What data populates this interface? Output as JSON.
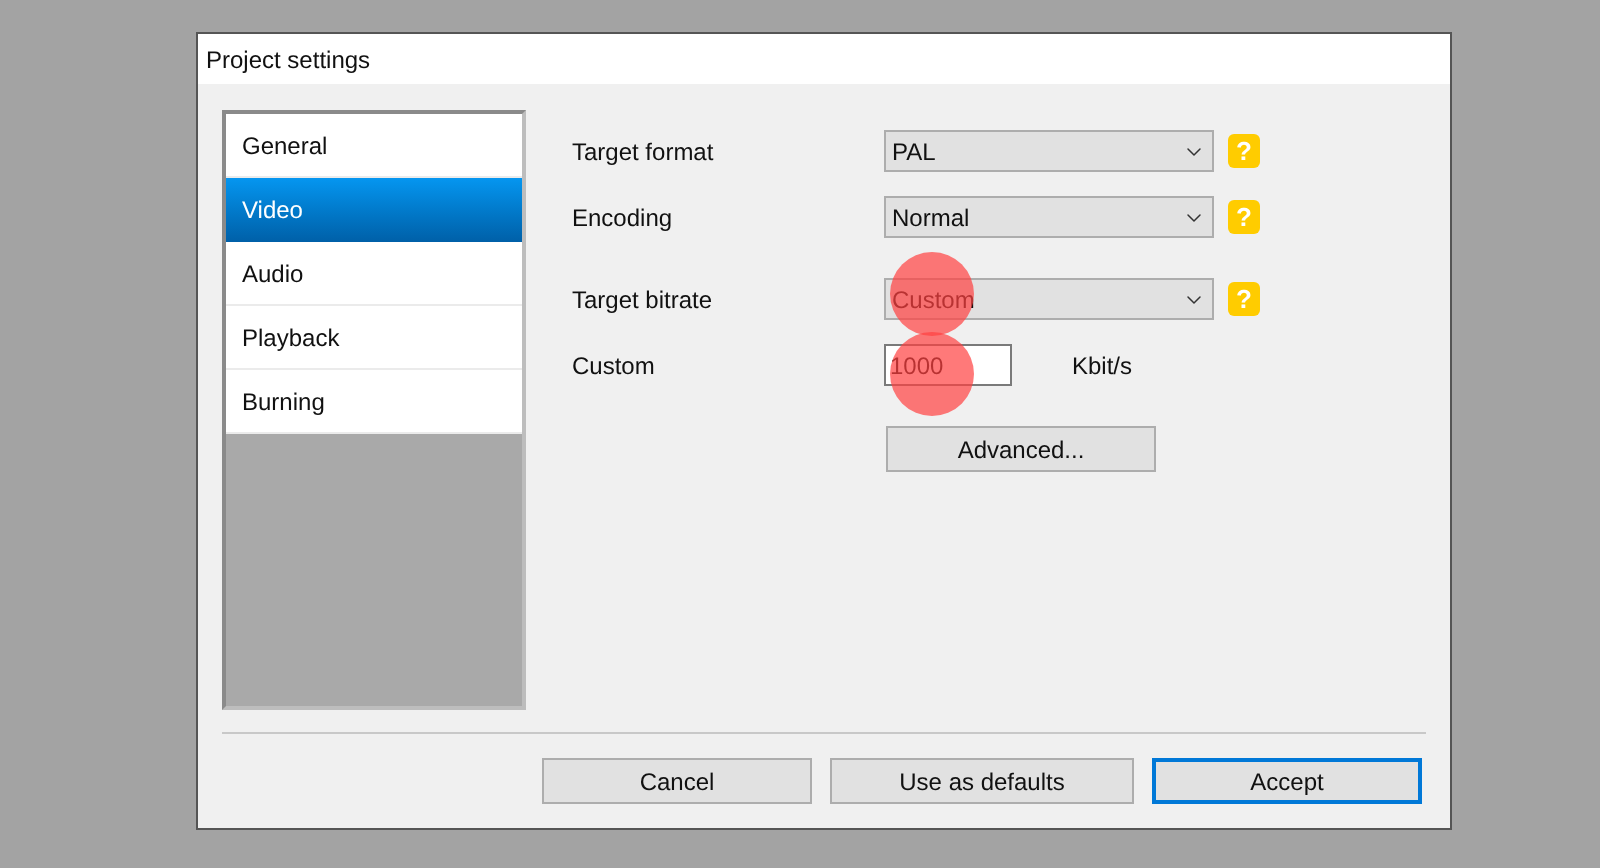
{
  "window": {
    "title": "Project settings"
  },
  "sidebar": {
    "items": [
      {
        "label": "General",
        "selected": false
      },
      {
        "label": "Video",
        "selected": true
      },
      {
        "label": "Audio",
        "selected": false
      },
      {
        "label": "Playback",
        "selected": false
      },
      {
        "label": "Burning",
        "selected": false
      }
    ]
  },
  "settings": [
    {
      "kind": "dropdown",
      "label": "Target format",
      "value": "PAL",
      "help": "?"
    },
    {
      "kind": "dropdown",
      "label": "Encoding",
      "value": "Normal",
      "help": "?"
    },
    {
      "kind": "dropdown",
      "label": "Target bitrate",
      "value": "Custom",
      "help": "?"
    },
    {
      "kind": "number",
      "label": "Custom",
      "value": "1000",
      "unit": "Kbit/s"
    }
  ],
  "advanced_button": "Advanced...",
  "buttons": [
    {
      "label": "Cancel",
      "selected": false
    },
    {
      "label": "Use as defaults",
      "selected": false
    },
    {
      "label": "Accept",
      "selected": true
    }
  ]
}
